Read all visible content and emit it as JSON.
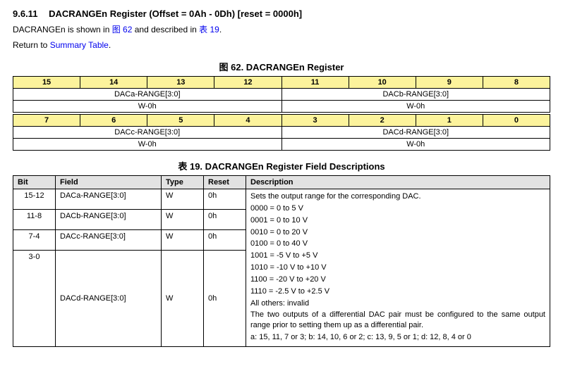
{
  "heading": {
    "number": "9.6.11",
    "title": "DACRANGEn Register (Offset = 0Ah - 0Dh) [reset = 0000h]"
  },
  "intro": {
    "prefix": "DACRANGEn is shown in ",
    "fig_link": "图 62",
    "mid": " and described in ",
    "tab_link": "表 19",
    "suffix": "."
  },
  "return": {
    "prefix": "Return to ",
    "link": "Summary Table",
    "suffix": "."
  },
  "fig_caption": "图 62.  DACRANGEn Register",
  "reg_top": {
    "bits": [
      "15",
      "14",
      "13",
      "12",
      "11",
      "10",
      "9",
      "8"
    ],
    "fields": [
      "DACa-RANGE[3:0]",
      "DACb-RANGE[3:0]"
    ],
    "rw": [
      "W-0h",
      "W-0h"
    ]
  },
  "reg_bot": {
    "bits": [
      "7",
      "6",
      "5",
      "4",
      "3",
      "2",
      "1",
      "0"
    ],
    "fields": [
      "DACc-RANGE[3:0]",
      "DACd-RANGE[3:0]"
    ],
    "rw": [
      "W-0h",
      "W-0h"
    ]
  },
  "tab_caption": "表 19. DACRANGEn Register Field Descriptions",
  "fld_head": [
    "Bit",
    "Field",
    "Type",
    "Reset",
    "Description"
  ],
  "fld_rows": [
    {
      "bit": "15-12",
      "field": "DACa-RANGE[3:0]",
      "type": "W",
      "reset": "0h"
    },
    {
      "bit": "11-8",
      "field": "DACb-RANGE[3:0]",
      "type": "W",
      "reset": "0h"
    },
    {
      "bit": "7-4",
      "field": "DACc-RANGE[3:0]",
      "type": "W",
      "reset": "0h"
    },
    {
      "bit": "3-0",
      "field": "DACd-RANGE[3:0]",
      "type": "W",
      "reset": "0h"
    }
  ],
  "desc_lines": [
    "Sets the output range for the corresponding DAC.",
    "0000 = 0 to 5 V",
    "0001 = 0 to 10 V",
    "0010 = 0 to 20 V",
    "0100 = 0 to 40 V",
    "1001 = -5 V to +5 V",
    "1010 = -10 V to +10 V",
    "1100 = -20 V to +20 V",
    "1110 = -2.5 V to +2.5 V",
    "All others: invalid"
  ],
  "desc_just": "The two outputs of a differential DAC pair must be configured to the same output range prior to setting them up as a differential pair.",
  "desc_note": "a: 15, 11, 7 or 3; b: 14, 10, 6 or 2; c: 13, 9, 5 or 1; d: 12, 8, 4 or 0"
}
